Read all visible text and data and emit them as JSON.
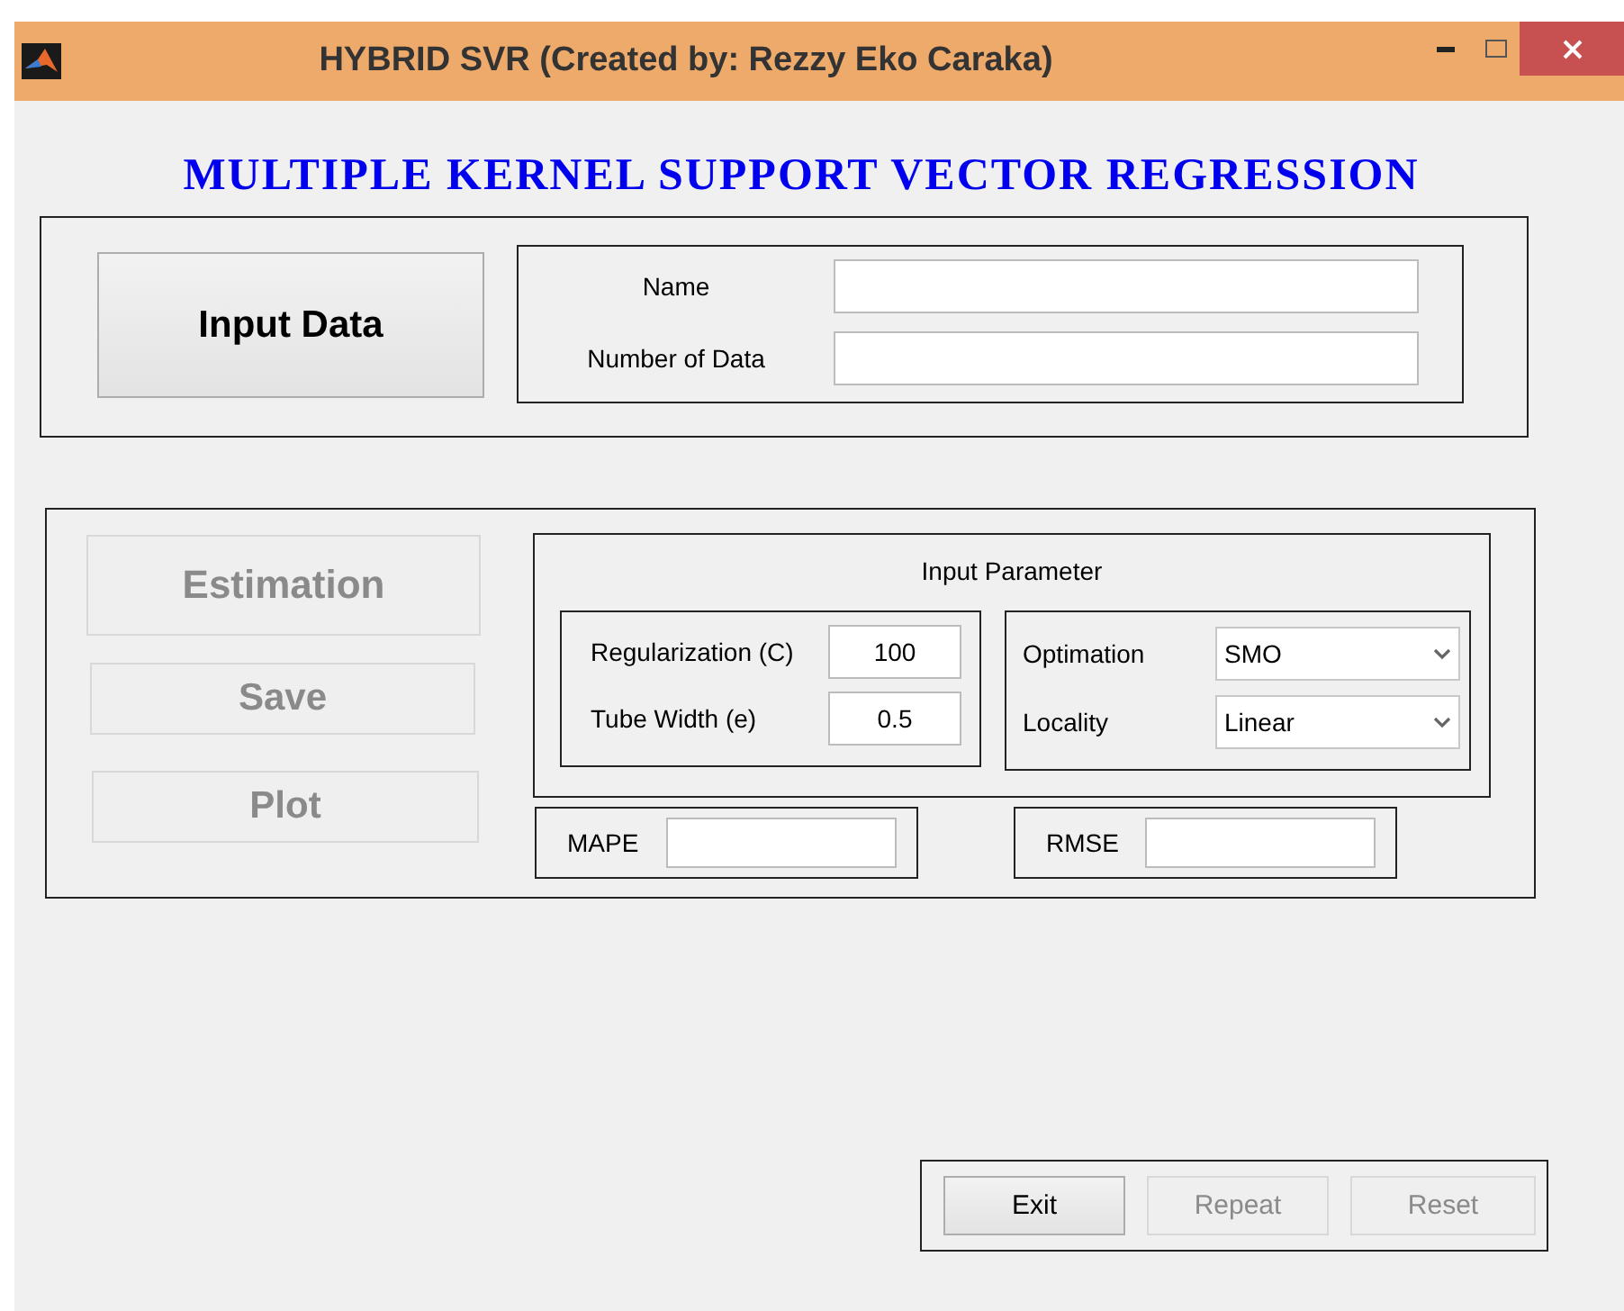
{
  "window": {
    "title": "HYBRID SVR (Created by: Rezzy Eko Caraka)"
  },
  "heading": "MULTIPLE KERNEL SUPPORT VECTOR REGRESSION",
  "input_panel": {
    "button": {
      "label": "Input Data",
      "disabled": false
    },
    "fields": [
      {
        "label": "Name"
      },
      {
        "label": "Number of Data"
      }
    ]
  },
  "actions": [
    {
      "label": "Estimation",
      "disabled": true
    },
    {
      "label": "Save",
      "disabled": true
    },
    {
      "label": "Plot",
      "disabled": true
    }
  ],
  "parameters": {
    "title": "Input Parameter",
    "values": [
      {
        "label": "Regularization (C)",
        "value": "100"
      },
      {
        "label": "Tube Width (e)",
        "value": "0.5"
      }
    ],
    "choices": [
      {
        "label": "Optimation",
        "value": "SMO"
      },
      {
        "label": "Locality",
        "value": "Linear"
      }
    ]
  },
  "results": [
    {
      "label": "MAPE"
    },
    {
      "label": "RMSE"
    }
  ],
  "footer_buttons": [
    {
      "label": "Exit",
      "disabled": false
    },
    {
      "label": "Repeat",
      "disabled": true
    },
    {
      "label": "Reset",
      "disabled": true
    }
  ]
}
